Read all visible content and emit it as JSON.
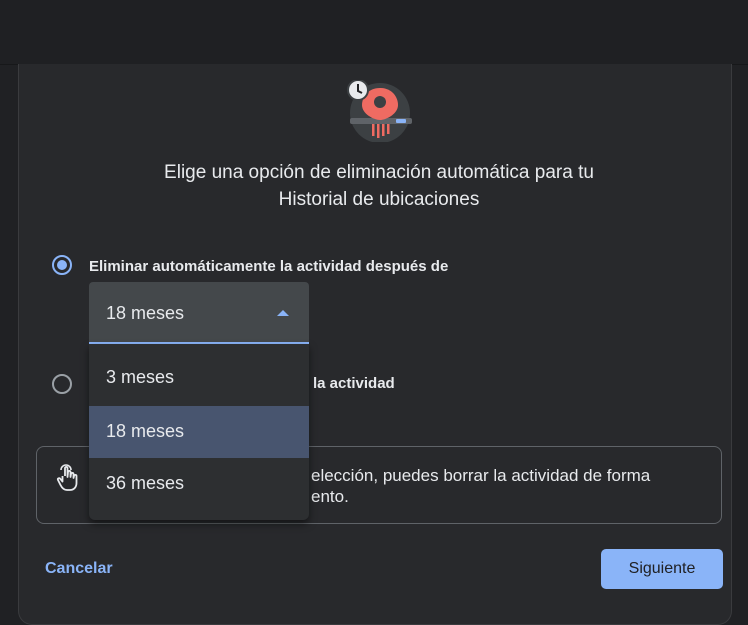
{
  "dialog": {
    "title_line1": "Elige una opción de eliminación automática para tu",
    "title_line2": "Historial de ubicaciones",
    "option1_label": "Eliminar automáticamente la actividad después de",
    "option2_label_visible": "la actividad",
    "option1_selected": true,
    "dropdown": {
      "selected": "18 meses",
      "options": [
        "3 meses",
        "18 meses",
        "36 meses"
      ]
    },
    "notice_line1_visible": "elección, puedes borrar la actividad de forma",
    "notice_line2_visible": "ento.",
    "cancel_label": "Cancelar",
    "next_label": "Siguiente"
  },
  "icons": {
    "hero": "location-history-autodelete-icon",
    "notice": "touch-hand-icon",
    "dropdown_arrow": "arrow-up-icon"
  },
  "colors": {
    "accent": "#8ab4f8",
    "background": "#202124",
    "dialog": "#28292c",
    "highlight": "#48556f",
    "pin": "#ef6b62"
  }
}
